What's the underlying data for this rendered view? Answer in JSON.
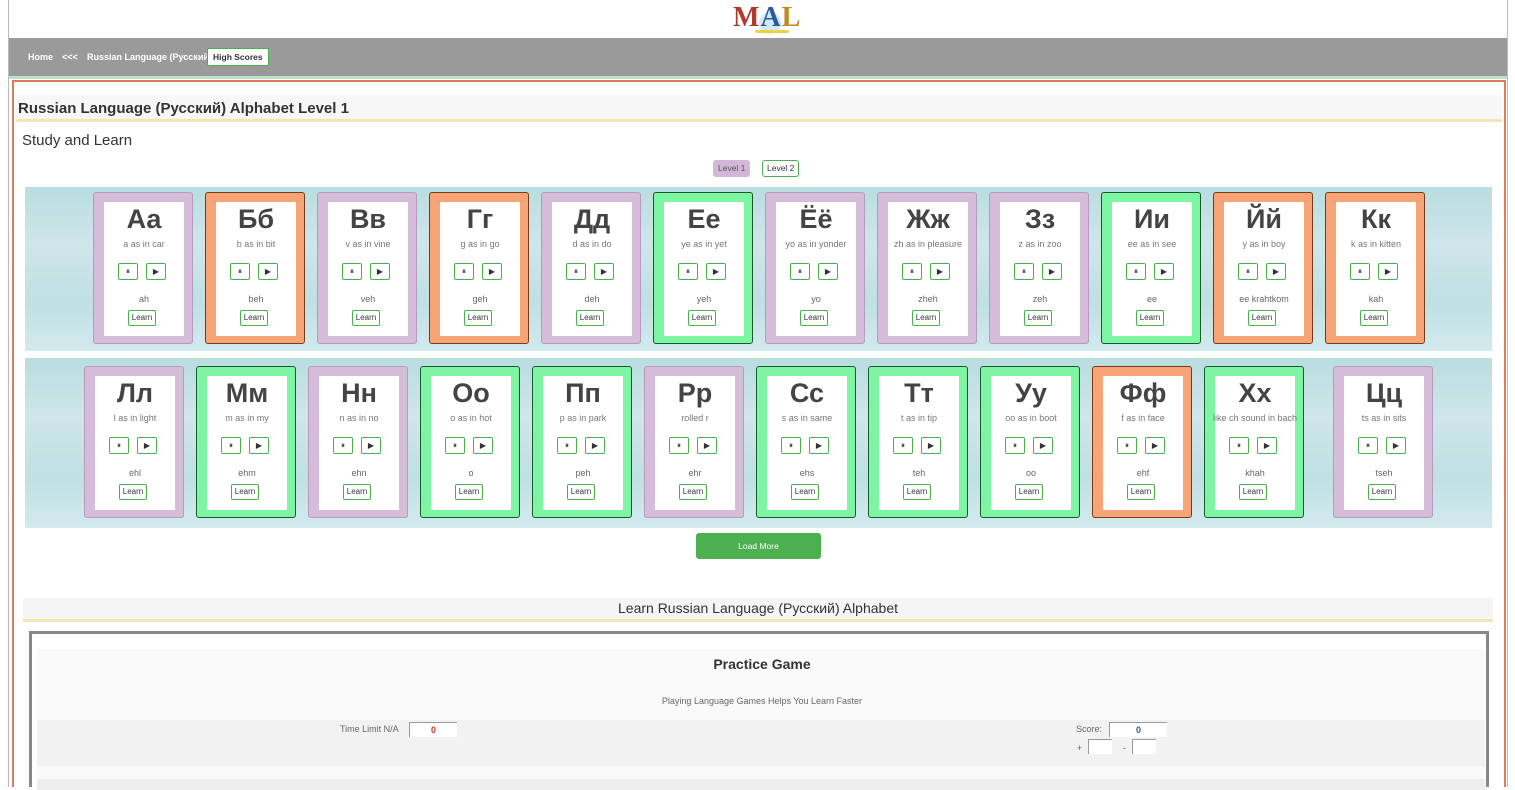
{
  "logo": {
    "m": "M",
    "a": "A",
    "l": "L"
  },
  "nav": {
    "home": "Home",
    "back": "<<<",
    "section": "Russian Language (Русский)",
    "high_scores": "High Scores"
  },
  "page_title": "Russian Language (Русский) Alphabet Level 1",
  "study_heading": "Study and Learn",
  "levels": [
    "Level 1",
    "Level 2"
  ],
  "controls": {
    "pause": "⏸",
    "play": "▶",
    "learn": "Learn"
  },
  "cards": [
    {
      "letter": "Аа",
      "sound": "a as in car",
      "pron": "ah",
      "color": "purple"
    },
    {
      "letter": "Бб",
      "sound": "b as in bit",
      "pron": "beh",
      "color": "orange"
    },
    {
      "letter": "Вв",
      "sound": "v as in vine",
      "pron": "veh",
      "color": "purple"
    },
    {
      "letter": "Гг",
      "sound": "g as in go",
      "pron": "geh",
      "color": "orange"
    },
    {
      "letter": "Дд",
      "sound": "d as in do",
      "pron": "deh",
      "color": "purple"
    },
    {
      "letter": "Ее",
      "sound": "ye as in yet",
      "pron": "yeh",
      "color": "green"
    },
    {
      "letter": "Ёё",
      "sound": "yo as in yonder",
      "pron": "yo",
      "color": "purple"
    },
    {
      "letter": "Жж",
      "sound": "zh as in pleasure",
      "pron": "zheh",
      "color": "purple"
    },
    {
      "letter": "Зз",
      "sound": "z as in zoo",
      "pron": "zeh",
      "color": "purple"
    },
    {
      "letter": "Ии",
      "sound": "ee as in see",
      "pron": "ee",
      "color": "green"
    },
    {
      "letter": "Йй",
      "sound": "y as in boy",
      "pron": "ee krahtkom",
      "color": "orange"
    },
    {
      "letter": "Кк",
      "sound": "k as in kitten",
      "pron": "kah",
      "color": "orange"
    },
    {
      "letter": "Лл",
      "sound": "l as in light",
      "pron": "ehl",
      "color": "purple"
    },
    {
      "letter": "Мм",
      "sound": "m as in my",
      "pron": "ehm",
      "color": "green"
    },
    {
      "letter": "Нн",
      "sound": "n as in no",
      "pron": "ehn",
      "color": "purple"
    },
    {
      "letter": "Оо",
      "sound": "o as in hot",
      "pron": "o",
      "color": "green"
    },
    {
      "letter": "Пп",
      "sound": "p as in park",
      "pron": "peh",
      "color": "green"
    },
    {
      "letter": "Рр",
      "sound": "rolled r",
      "pron": "ehr",
      "color": "purple"
    },
    {
      "letter": "Сс",
      "sound": "s as in same",
      "pron": "ehs",
      "color": "green"
    },
    {
      "letter": "Тт",
      "sound": "t as in tip",
      "pron": "teh",
      "color": "green"
    },
    {
      "letter": "Уу",
      "sound": "oo as in boot",
      "pron": "oo",
      "color": "green"
    },
    {
      "letter": "Фф",
      "sound": "f as in face",
      "pron": "ehf",
      "color": "orange"
    },
    {
      "letter": "Хх",
      "sound": "like ch sound in bach",
      "pron": "khah",
      "color": "green"
    },
    {
      "letter": "Цц",
      "sound": "ts as in sits",
      "pron": "tseh",
      "color": "purple"
    }
  ],
  "load_more": "Load More",
  "learn_heading": "Learn Russian Language (Русский) Alphabet",
  "practice": {
    "title": "Practice Game",
    "subtitle": "Playing Language Games Helps You Learn Faster",
    "time_label": "Time Limit N/A",
    "time_value": "0",
    "score_label": "Score:",
    "score_value": "0",
    "plus": "+",
    "minus": "-"
  },
  "colors": {
    "purple": "#d5bcd9",
    "orange": "#f7a477",
    "green": "#7df5a3",
    "nav": "#9a9a9a",
    "accent": "#4caf50"
  }
}
